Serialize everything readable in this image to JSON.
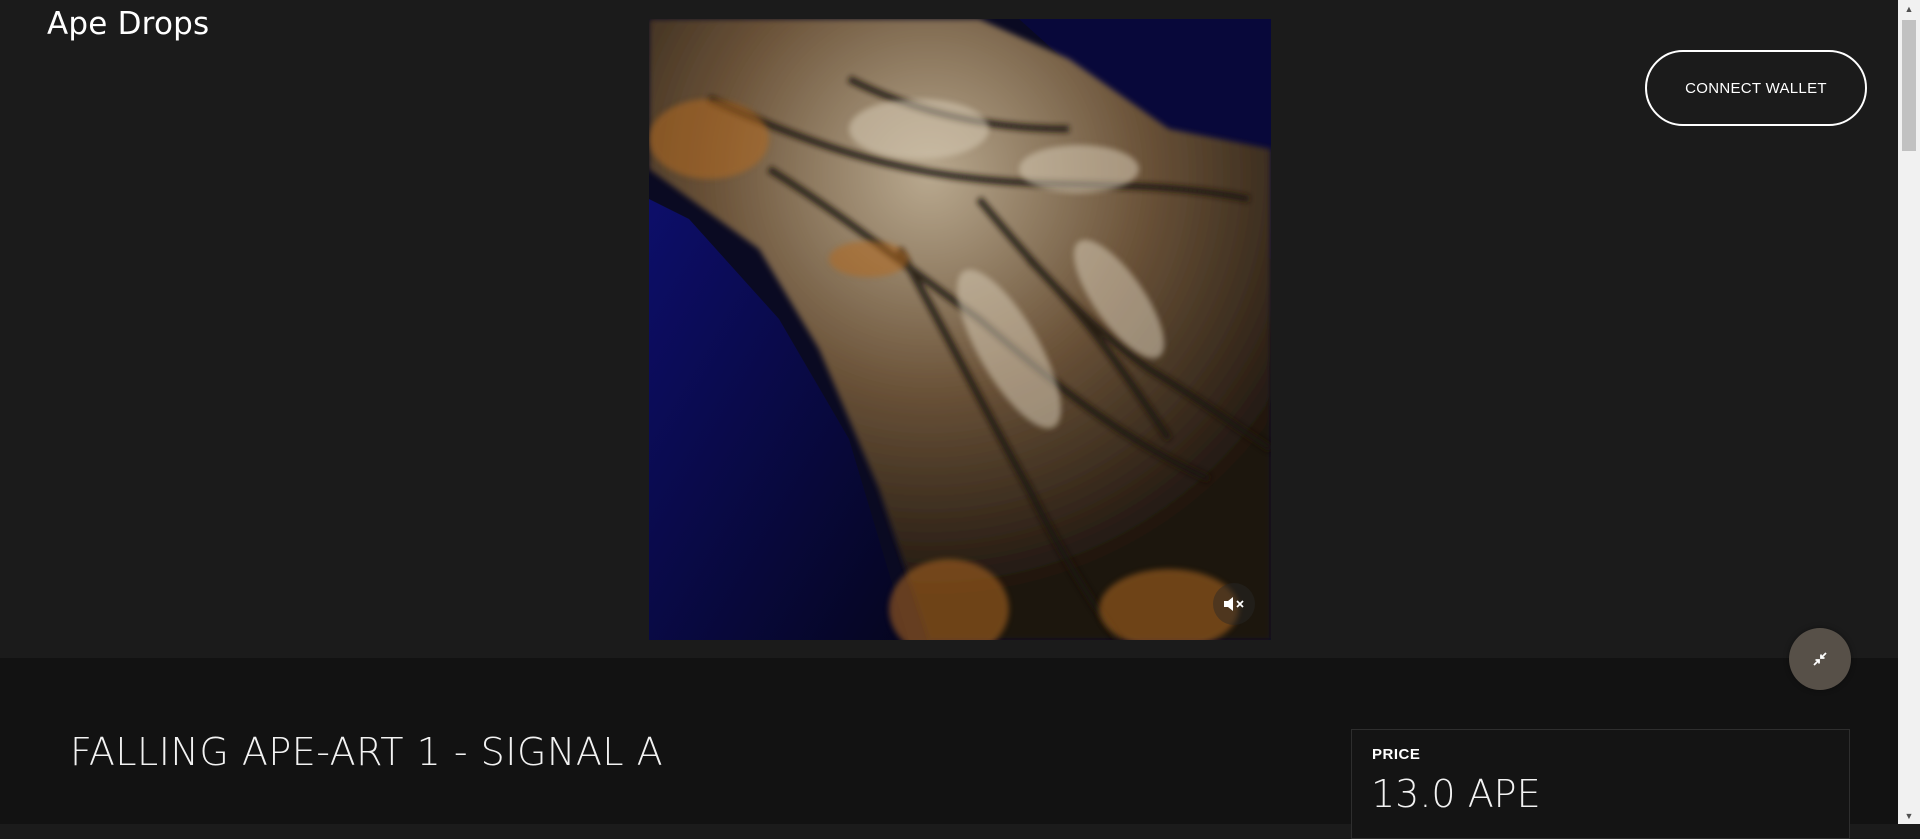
{
  "header": {
    "brand": "Ape Drops",
    "connect_label": "CONNECT WALLET"
  },
  "media": {
    "mute_icon": "speaker-muted-icon",
    "expand_icon": "collapse-arrows-icon"
  },
  "item": {
    "title": "FALLING APE-ART 1 - SIGNAL A",
    "price_label": "PRICE",
    "price_value": "13.0 APE"
  },
  "scrollbar": {
    "up_icon": "▲",
    "down_icon": "▼"
  }
}
